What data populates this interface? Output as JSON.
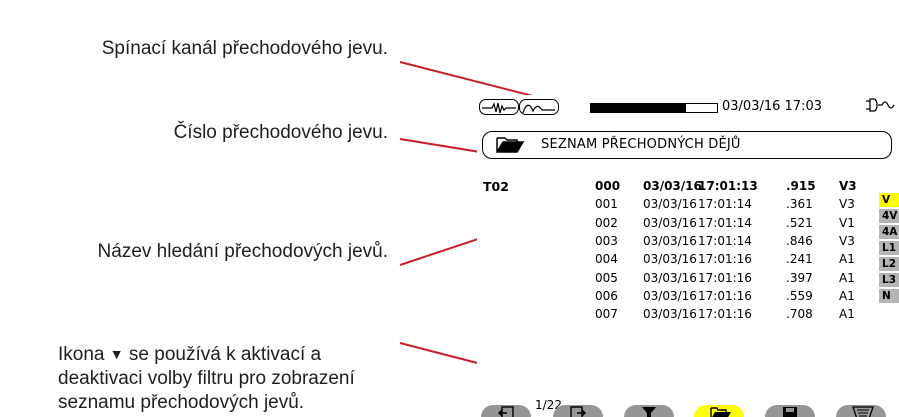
{
  "callouts": {
    "trigger_channel": "Spínací kanál přechodového jevu.",
    "transient_number": "Číslo přechodového jevu.",
    "search_name": "Název hledání přechodových jevů.",
    "filter_before": "Ikona",
    "filter_after": "se používá k aktivací a deaktivaci volby filtru pro zobrazení seznamu přechodových jevů."
  },
  "screen": {
    "status": {
      "datetime": "03/03/16  17:03",
      "progress": 0.75
    },
    "title": "SEZNAM PŘECHODNÝCH DĚJŮ",
    "search_name": "T02",
    "rows": [
      {
        "num": "000",
        "date": "03/03/16",
        "time": "17:01:13",
        "duration": ".915",
        "channel": "V3",
        "bold": true
      },
      {
        "num": "001",
        "date": "03/03/16",
        "time": "17:01:14",
        "duration": ".361",
        "channel": "V3"
      },
      {
        "num": "002",
        "date": "03/03/16",
        "time": "17:01:14",
        "duration": ".521",
        "channel": "V1"
      },
      {
        "num": "003",
        "date": "03/03/16",
        "time": "17:01:14",
        "duration": ".846",
        "channel": "V3"
      },
      {
        "num": "004",
        "date": "03/03/16",
        "time": "17:01:16",
        "duration": ".241",
        "channel": "A1"
      },
      {
        "num": "005",
        "date": "03/03/16",
        "time": "17:01:16",
        "duration": ".397",
        "channel": "A1"
      },
      {
        "num": "006",
        "date": "03/03/16",
        "time": "17:01:16",
        "duration": ".559",
        "channel": "A1"
      },
      {
        "num": "007",
        "date": "03/03/16",
        "time": "17:01:16",
        "duration": ".708",
        "channel": "A1"
      }
    ],
    "side_tabs": [
      {
        "label": "V",
        "active": true
      },
      {
        "label": "4V"
      },
      {
        "label": "4A"
      },
      {
        "label": "L1"
      },
      {
        "label": "L2"
      },
      {
        "label": "L3"
      },
      {
        "label": "N"
      }
    ],
    "page_indicator": "1/22",
    "function_keys": [
      {
        "icon": "page-back-icon"
      },
      {
        "icon": "page-forward-icon"
      },
      {
        "icon": "filter-icon"
      },
      {
        "icon": "open-folder-icon",
        "active": true
      },
      {
        "icon": "save-icon"
      },
      {
        "icon": "trash-icon"
      }
    ]
  },
  "colors": {
    "leader_line": "#c8202a",
    "highlight": "#ffff00",
    "tab_gray": "#b4b4b4",
    "fkey_gray": "#969696"
  }
}
